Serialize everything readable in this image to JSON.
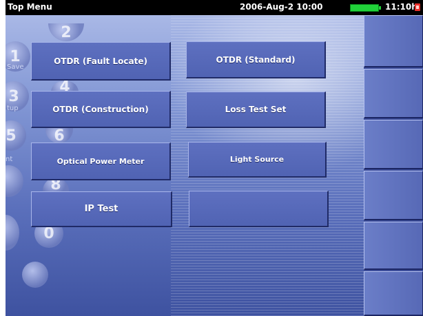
{
  "titlebar": {
    "title": "Top Menu",
    "datetime": "2006-Aug-2 10:00",
    "battery_time": "11:10h"
  },
  "background_keypad": {
    "keys": [
      "1",
      "2",
      "3",
      "4",
      "5",
      "6",
      "8",
      "0"
    ],
    "labels": [
      "Save",
      "tup",
      "nt"
    ]
  },
  "menu": {
    "otdr_fault_locate": "OTDR (Fault Locate)",
    "otdr_standard": "OTDR (Standard)",
    "otdr_construction": "OTDR (Construction)",
    "loss_test_set": "Loss Test Set",
    "optical_power_meter": "Optical Power Meter",
    "light_source": "Light Source",
    "ip_test": "IP Test",
    "empty": ""
  },
  "colors": {
    "titlebar": "#000000",
    "battery": "#21d23a",
    "power_icon": "#e8302a",
    "button": "#5a6cbb"
  },
  "icons": {
    "battery": "battery-icon",
    "power": "power-icon"
  }
}
